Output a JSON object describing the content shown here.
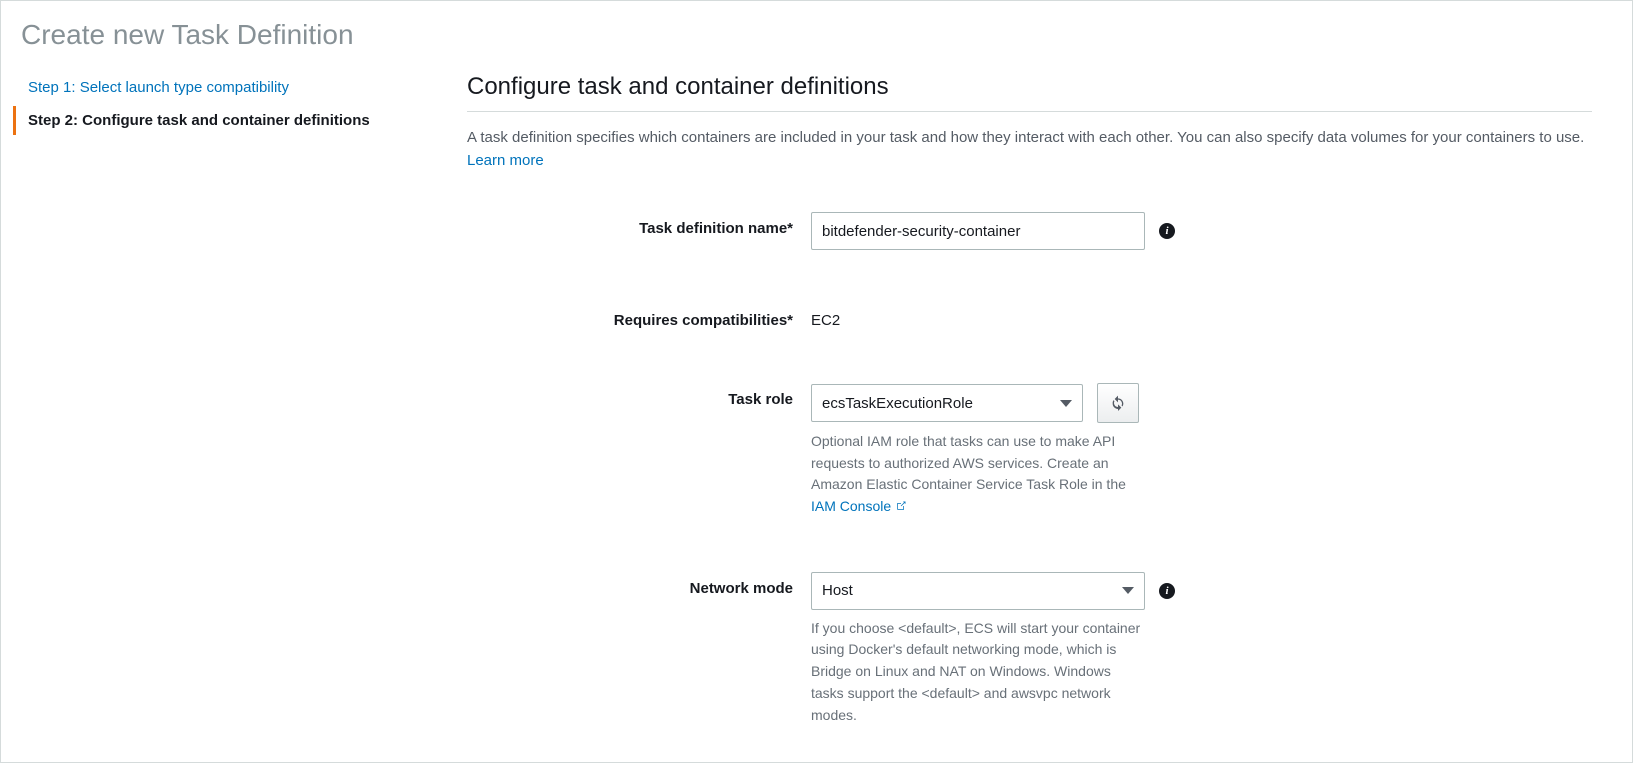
{
  "page_title": "Create new Task Definition",
  "sidebar": {
    "steps": [
      {
        "label": "Step 1: Select launch type compatibility",
        "active": false
      },
      {
        "label": "Step 2: Configure task and container definitions",
        "active": true
      }
    ]
  },
  "main": {
    "section_title": "Configure task and container definitions",
    "description": "A task definition specifies which containers are included in your task and how they interact with each other. You can also specify data volumes for your containers to use. ",
    "learn_more": "Learn more",
    "fields": {
      "task_definition_name": {
        "label": "Task definition name*",
        "value": "bitdefender-security-container"
      },
      "requires_compatibilities": {
        "label": "Requires compatibilities*",
        "value": "EC2"
      },
      "task_role": {
        "label": "Task role",
        "selected": "ecsTaskExecutionRole",
        "help_prefix": "Optional IAM role that tasks can use to make API requests to authorized AWS services. Create an Amazon Elastic Container Service Task Role in the ",
        "help_link": "IAM Console"
      },
      "network_mode": {
        "label": "Network mode",
        "selected": "Host",
        "help": "If you choose <default>, ECS will start your container using Docker's default networking mode, which is Bridge on Linux and NAT on Windows. Windows tasks support the <default> and awsvpc network modes."
      }
    }
  }
}
